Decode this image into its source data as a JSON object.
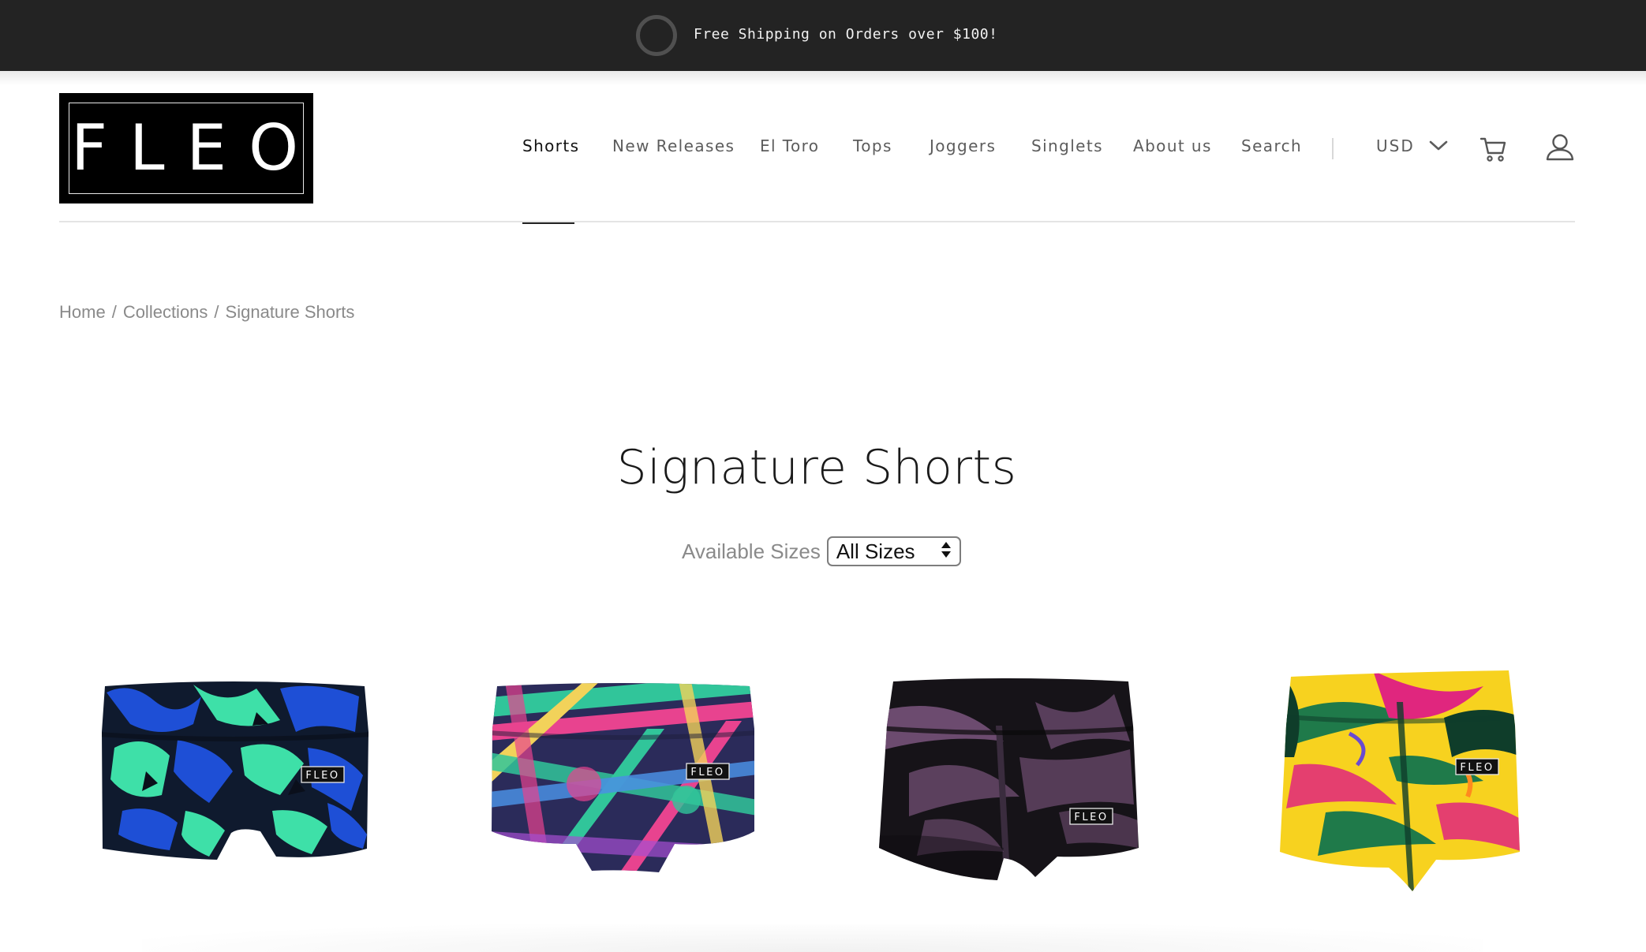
{
  "announcement": {
    "text": "Free Shipping on Orders over $100!"
  },
  "brand": {
    "logo_text": "FLEO"
  },
  "nav": {
    "items": [
      {
        "label": "Shorts",
        "active": true
      },
      {
        "label": "New Releases"
      },
      {
        "label": "El Toro"
      },
      {
        "label": "Tops"
      },
      {
        "label": "Joggers"
      },
      {
        "label": "Singlets"
      },
      {
        "label": "About us"
      },
      {
        "label": "Search"
      }
    ],
    "currency": "USD",
    "icons": [
      "chevron-down-icon",
      "cart-icon",
      "account-icon"
    ]
  },
  "breadcrumb": {
    "items": [
      "Home",
      "Collections",
      "Signature Shorts"
    ],
    "separator": "/"
  },
  "collection": {
    "title": "Signature Shorts",
    "filter_label": "Available Sizes",
    "filter_value": "All Sizes"
  },
  "products": [
    {
      "pattern": "blue-green-camo",
      "colors": [
        "#0f1a2e",
        "#1e4fd6",
        "#3ee0a8"
      ],
      "badge": "FLEO"
    },
    {
      "pattern": "multicolor-stripes",
      "colors": [
        "#31c59a",
        "#e8438f",
        "#3b3a9a"
      ],
      "badge": "FLEO"
    },
    {
      "pattern": "black-purple-leaf",
      "colors": [
        "#161318",
        "#8a5f8c",
        "#3a2c3e"
      ],
      "badge": "FLEO"
    },
    {
      "pattern": "yellow-tropical",
      "colors": [
        "#f7d21f",
        "#e0267e",
        "#1f7a4a"
      ],
      "badge": "FLEO"
    }
  ]
}
